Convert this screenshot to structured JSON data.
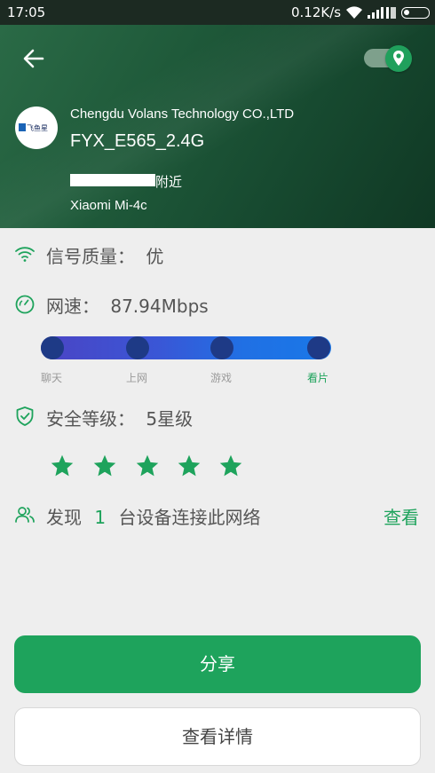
{
  "status_bar": {
    "time": "17:05",
    "net_speed": "0.12K/s",
    "wifi_icon": "wifi-icon",
    "signal_icon": "cell-signal-icon",
    "battery_icon": "battery-icon"
  },
  "header": {
    "back_icon": "back-arrow-icon",
    "location_toggle_icon": "location-pin-icon",
    "location_toggle_on": true,
    "logo_text": "飞鱼星",
    "company": "Chengdu Volans Technology CO.,LTD",
    "ssid": "FYX_E565_2.4G",
    "location_suffix": "附近",
    "device": "Xiaomi Mi-4c"
  },
  "signal": {
    "label": "信号质量：",
    "value": "优"
  },
  "speed": {
    "label": "网速：",
    "value": "87.94Mbps",
    "levels": [
      "聊天",
      "上网",
      "游戏",
      "看片"
    ],
    "active_level": "看片"
  },
  "security": {
    "label": "安全等级：",
    "value": "5星级",
    "stars": 5,
    "star_max": 5
  },
  "devices": {
    "prefix": "发现",
    "count": "1",
    "suffix": "台设备连接此网络",
    "view_label": "查看"
  },
  "buttons": {
    "share": "分享",
    "details": "查看详情"
  },
  "colors": {
    "accent": "#1ea35c",
    "header_bg": "#1f5a3a",
    "status_bar_bg": "#1c2a22"
  }
}
